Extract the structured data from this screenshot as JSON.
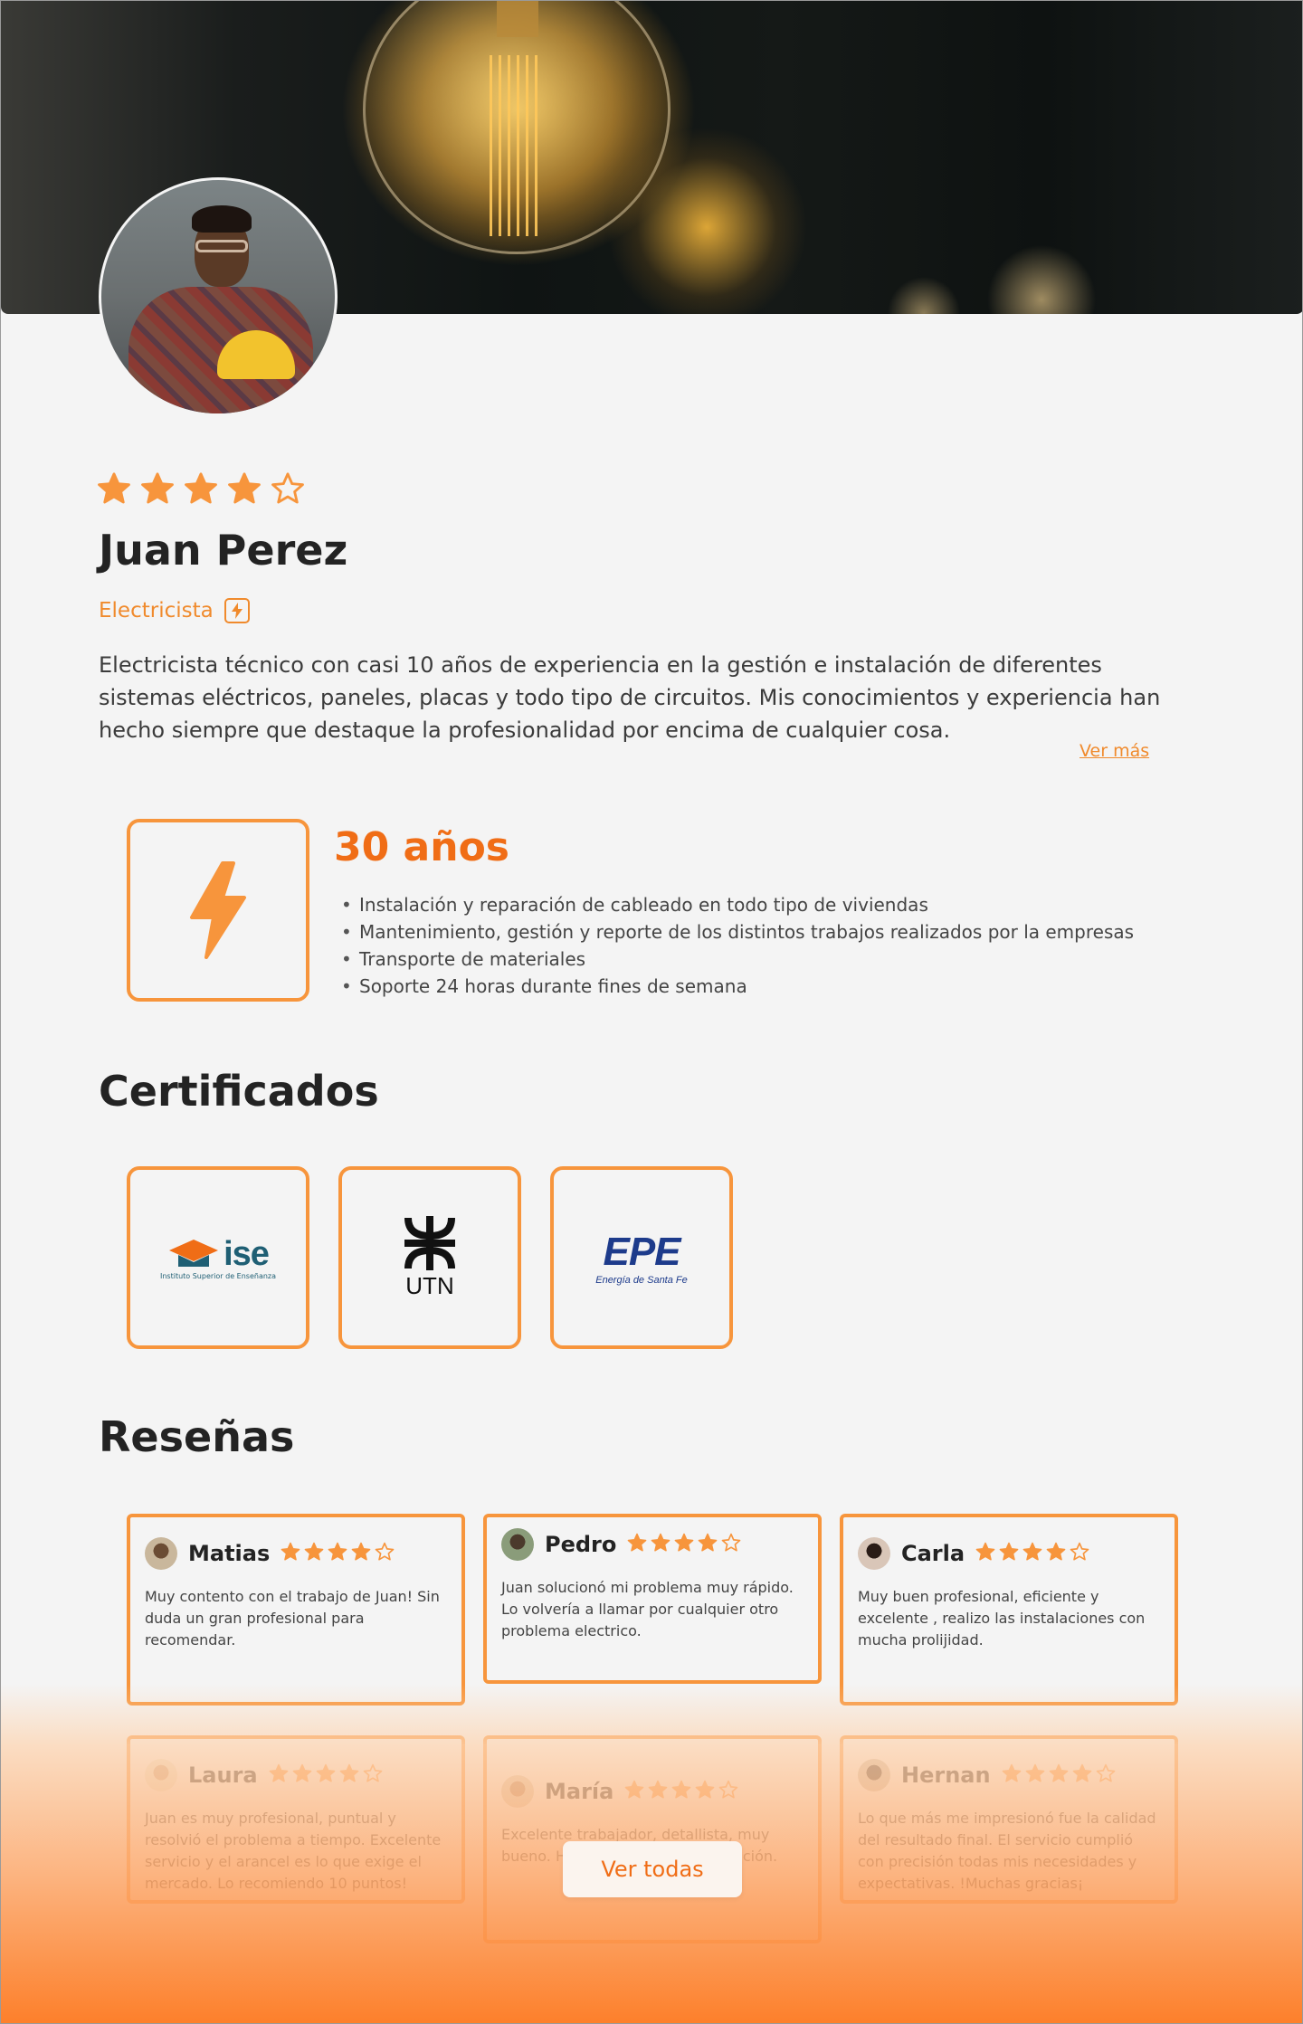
{
  "profile": {
    "rating": 4,
    "name": "Juan Perez",
    "role": "Electricista",
    "bio": "Electricista técnico con casi 10 años de experiencia en la gestión e instalación de diferentes sistemas eléctricos, paneles, placas y todo tipo de circuitos. Mis conocimientos y experiencia han hecho siempre que destaque la profesionalidad por encima de cualquier cosa.",
    "more_label": "Ver más"
  },
  "experience": {
    "years": "30 años",
    "items": [
      "Instalación y reparación de cableado en todo tipo de viviendas",
      "Mantenimiento, gestión y reporte de los distintos trabajos realizados por la empresas",
      "Transporte de materiales",
      "Soporte 24 horas durante fines de semana"
    ]
  },
  "certificates": {
    "title": "Certificados",
    "items": [
      {
        "logo": "ise",
        "name": "ise",
        "subtitle": "Instituto Superior de Enseñanza"
      },
      {
        "logo": "utn",
        "name": "UTN"
      },
      {
        "logo": "epe",
        "name": "EPE",
        "subtitle": "Energía de Santa Fe"
      }
    ]
  },
  "reviews": {
    "title": "Reseñas",
    "items": [
      {
        "name": "Matias",
        "rating": 4,
        "text": "Muy contento con el trabajo de Juan! Sin duda un gran profesional para recomendar."
      },
      {
        "name": "Pedro",
        "rating": 4,
        "text": "Juan solucionó mi problema muy rápido. Lo volvería a llamar por cualquier otro problema electrico."
      },
      {
        "name": "Carla",
        "rating": 4,
        "text": "Muy buen profesional, eficiente y excelente , realizo las instalaciones con mucha prolijidad."
      },
      {
        "name": "Laura",
        "rating": 4,
        "text": "Juan es muy profesional, puntual y resolvió el problema a tiempo. Excelente servicio y el arancel es lo que exige el mercado. Lo recomiendo 10 puntos!"
      },
      {
        "name": "María",
        "rating": 4,
        "text": "Excelente trabajador, detallista, muy bueno. H...eta, pisos. To... disposición."
      },
      {
        "name": "Hernan",
        "rating": 4,
        "text": "Lo que más me impresionó fue la calidad del resultado final. El servicio cumplió con precisión todas mis necesidades y expectativas. !Muchas gracias¡"
      }
    ],
    "see_all_label": "Ver todas"
  },
  "colors": {
    "accent": "#f7953c",
    "accent_dark": "#f06d16"
  }
}
